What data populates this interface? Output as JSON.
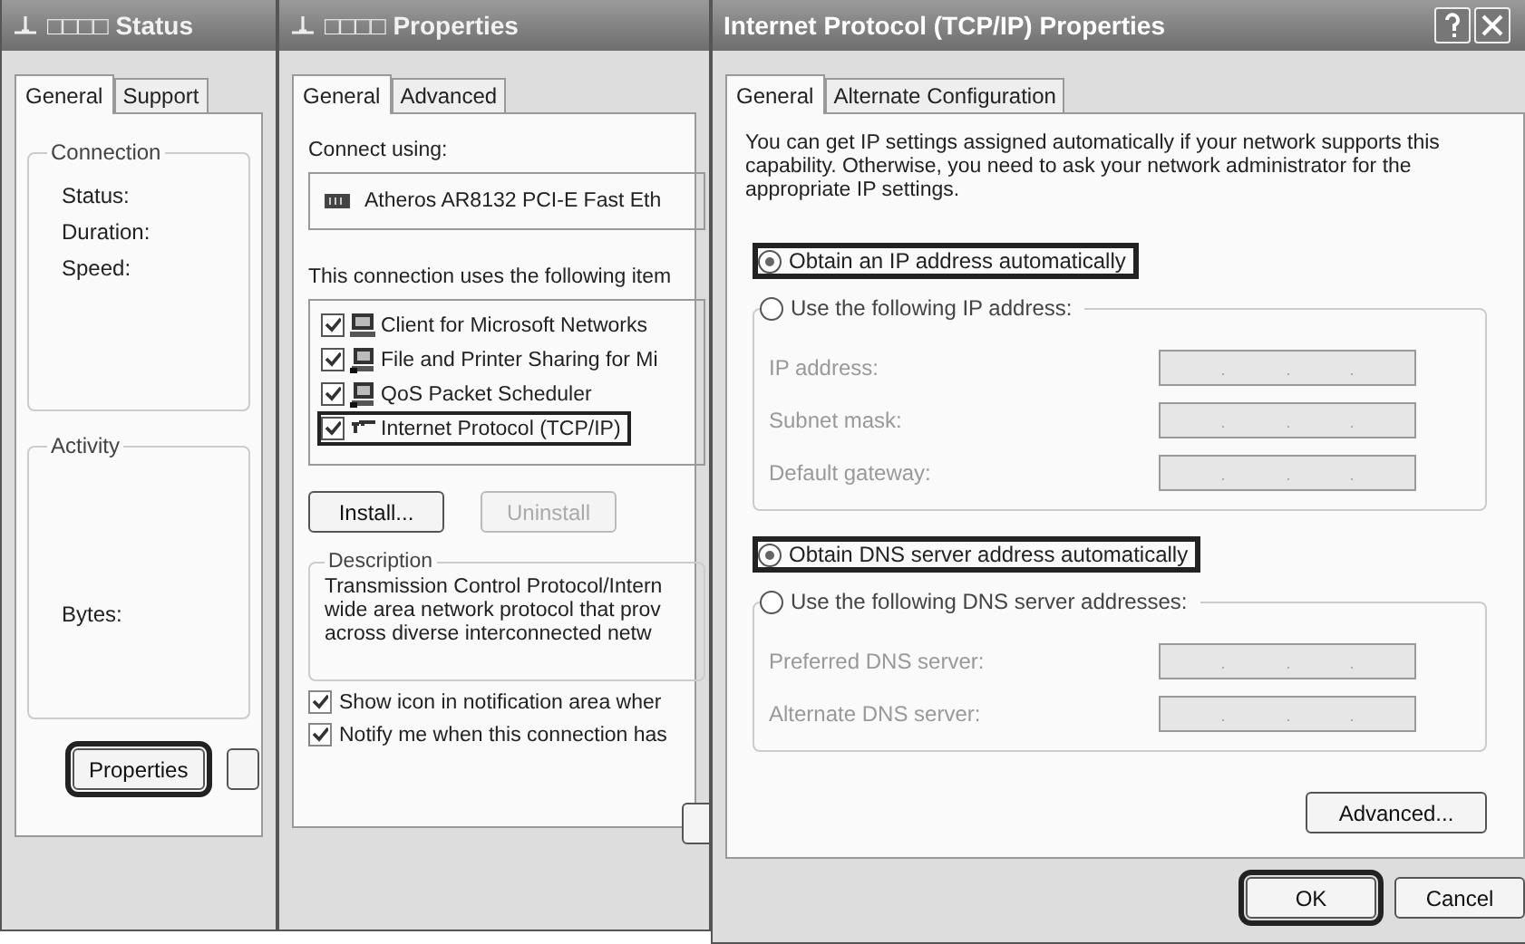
{
  "status_window": {
    "title": "□□□□ Status",
    "tabs": [
      {
        "label": "General",
        "selected": true
      },
      {
        "label": "Support",
        "selected": false
      }
    ],
    "connection": {
      "legend": "Connection",
      "rows": [
        "Status:",
        "Duration:",
        "Speed:"
      ]
    },
    "activity": {
      "legend": "Activity",
      "rows": [
        "Bytes:"
      ]
    },
    "buttons": [
      {
        "label": "Properties",
        "highlighted": true
      }
    ]
  },
  "properties_window": {
    "title": "□□□□ Properties",
    "tabs": [
      {
        "label": "General",
        "selected": true
      },
      {
        "label": "Advanced",
        "selected": false
      }
    ],
    "connect_using": {
      "label": "Connect using:",
      "adapter": "Atheros AR8132 PCI-E Fast Eth"
    },
    "items_label": "This connection uses the following item",
    "items": [
      {
        "kind": "client",
        "label": "Client for Microsoft Networks",
        "checked": true,
        "highlighted": false
      },
      {
        "kind": "service",
        "label": "File and Printer Sharing for Mi",
        "checked": true,
        "highlighted": false
      },
      {
        "kind": "service",
        "label": "QoS Packet Scheduler",
        "checked": true,
        "highlighted": false
      },
      {
        "kind": "protocol",
        "label": "Internet Protocol (TCP/IP)",
        "checked": true,
        "highlighted": true
      }
    ],
    "buttons": [
      {
        "label": "Install...",
        "disabled": false
      },
      {
        "label": "Uninstall",
        "disabled": true
      }
    ],
    "description": {
      "legend": "Description",
      "lines": [
        "Transmission Control Protocol/Intern",
        "wide area network protocol that prov",
        "across diverse interconnected netw"
      ]
    },
    "options": [
      {
        "label": "Show icon in notification area wher",
        "checked": true
      },
      {
        "label": "Notify me when this connection has",
        "checked": true
      }
    ]
  },
  "tcpip_window": {
    "title": "Internet Protocol (TCP/IP) Properties",
    "tabs": [
      {
        "label": "General",
        "selected": true
      },
      {
        "label": "Alternate Configuration",
        "selected": false
      }
    ],
    "intro": "You can get IP settings assigned automatically if your network supports this capability. Otherwise, you need to ask your network administrator for the appropriate IP settings.",
    "ip_modes": [
      {
        "label": "Obtain an IP address automatically",
        "selected": true,
        "highlighted": true
      },
      {
        "label": "Use the following IP address:",
        "selected": false,
        "highlighted": false
      }
    ],
    "ip_fields": [
      {
        "label": "IP address:",
        "disabled": true
      },
      {
        "label": "Subnet mask:",
        "disabled": true
      },
      {
        "label": "Default gateway:",
        "disabled": true
      }
    ],
    "dns_modes": [
      {
        "label": "Obtain DNS server address automatically",
        "selected": true,
        "highlighted": true
      },
      {
        "label": "Use the following DNS server addresses:",
        "selected": false,
        "highlighted": false
      }
    ],
    "dns_fields": [
      {
        "label": "Preferred DNS server:",
        "disabled": true
      },
      {
        "label": "Alternate DNS server:",
        "disabled": true
      }
    ],
    "advanced_button": "Advanced...",
    "buttons": [
      {
        "label": "OK",
        "highlighted": true
      },
      {
        "label": "Cancel",
        "highlighted": false
      }
    ]
  }
}
